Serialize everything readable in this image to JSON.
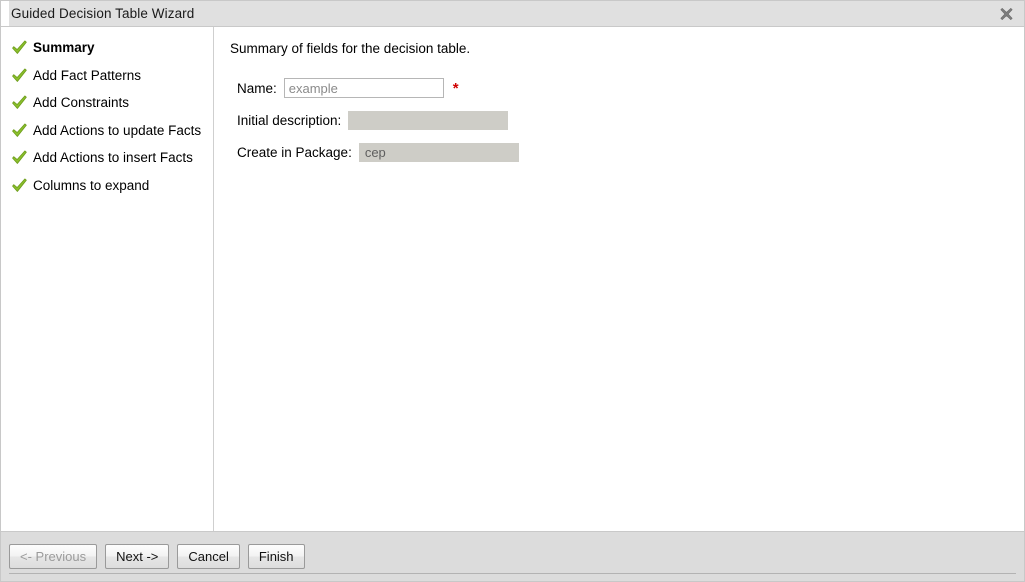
{
  "window": {
    "title": "Guided Decision Table Wizard",
    "close_icon": "close-icon"
  },
  "sidebar": {
    "items": [
      {
        "label": "Summary",
        "icon": "check-icon",
        "active": true
      },
      {
        "label": "Add Fact Patterns",
        "icon": "check-icon",
        "active": false
      },
      {
        "label": "Add Constraints",
        "icon": "check-icon",
        "active": false
      },
      {
        "label": "Add Actions to update Facts",
        "icon": "check-icon",
        "active": false
      },
      {
        "label": "Add Actions to insert Facts",
        "icon": "check-icon",
        "active": false
      },
      {
        "label": "Columns to expand",
        "icon": "check-icon",
        "active": false
      }
    ]
  },
  "content": {
    "heading": "Summary of fields for the decision table.",
    "fields": {
      "name": {
        "label": "Name:",
        "value": "",
        "placeholder": "example",
        "required_marker": "*"
      },
      "initial_description": {
        "label": "Initial description:",
        "value": ""
      },
      "create_in_package": {
        "label": "Create in Package:",
        "value": "cep"
      }
    }
  },
  "footer": {
    "buttons": [
      {
        "label": "<- Previous",
        "disabled": true
      },
      {
        "label": "Next ->",
        "disabled": false
      },
      {
        "label": "Cancel",
        "disabled": false
      },
      {
        "label": "Finish",
        "disabled": false
      }
    ]
  },
  "colors": {
    "titlebar_bg": "#e0e0e0",
    "footer_bg": "#dcdcdc",
    "content_bg": "#ffffff",
    "check_green": "#7ab317",
    "required_red": "#d00000",
    "disabled_field_bg": "#cecdc7"
  }
}
